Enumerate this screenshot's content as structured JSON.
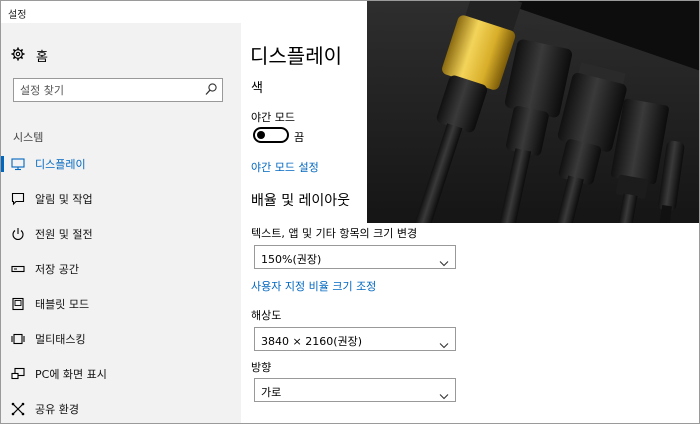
{
  "window": {
    "title": "설정"
  },
  "sidebar": {
    "home_label": "홈",
    "search_placeholder": "설정 찾기",
    "section_label": "시스템",
    "items": [
      {
        "label": "디스플레이",
        "icon": "monitor-icon",
        "active": true
      },
      {
        "label": "알림 및 작업",
        "icon": "notification-icon",
        "active": false
      },
      {
        "label": "전원 및 절전",
        "icon": "power-icon",
        "active": false
      },
      {
        "label": "저장 공간",
        "icon": "storage-icon",
        "active": false
      },
      {
        "label": "태블릿 모드",
        "icon": "tablet-icon",
        "active": false
      },
      {
        "label": "멀티태스킹",
        "icon": "multitasking-icon",
        "active": false
      },
      {
        "label": "PC에 화면 표시",
        "icon": "project-icon",
        "active": false
      },
      {
        "label": "공유 환경",
        "icon": "shared-experiences-icon",
        "active": false
      }
    ]
  },
  "content": {
    "page_title": "디스플레이",
    "color_heading": "색",
    "night_mode_label": "야간 모드",
    "night_mode_state": "끔",
    "night_mode_settings_link": "야간 모드 설정",
    "layout_heading": "배율 및 레이아웃",
    "scale_label": "텍스트, 앱 및 기타 항목의 크기 변경",
    "scale_value": "150%(권장)",
    "custom_scale_link": "사용자 지정 비율 크기 조정",
    "resolution_label": "해상도",
    "resolution_value": "3840 × 2160(권장)",
    "orientation_label": "방향",
    "orientation_value": "가로"
  },
  "colors": {
    "accent": "#0067c0",
    "sidebar_bg": "#f2f2f2"
  }
}
